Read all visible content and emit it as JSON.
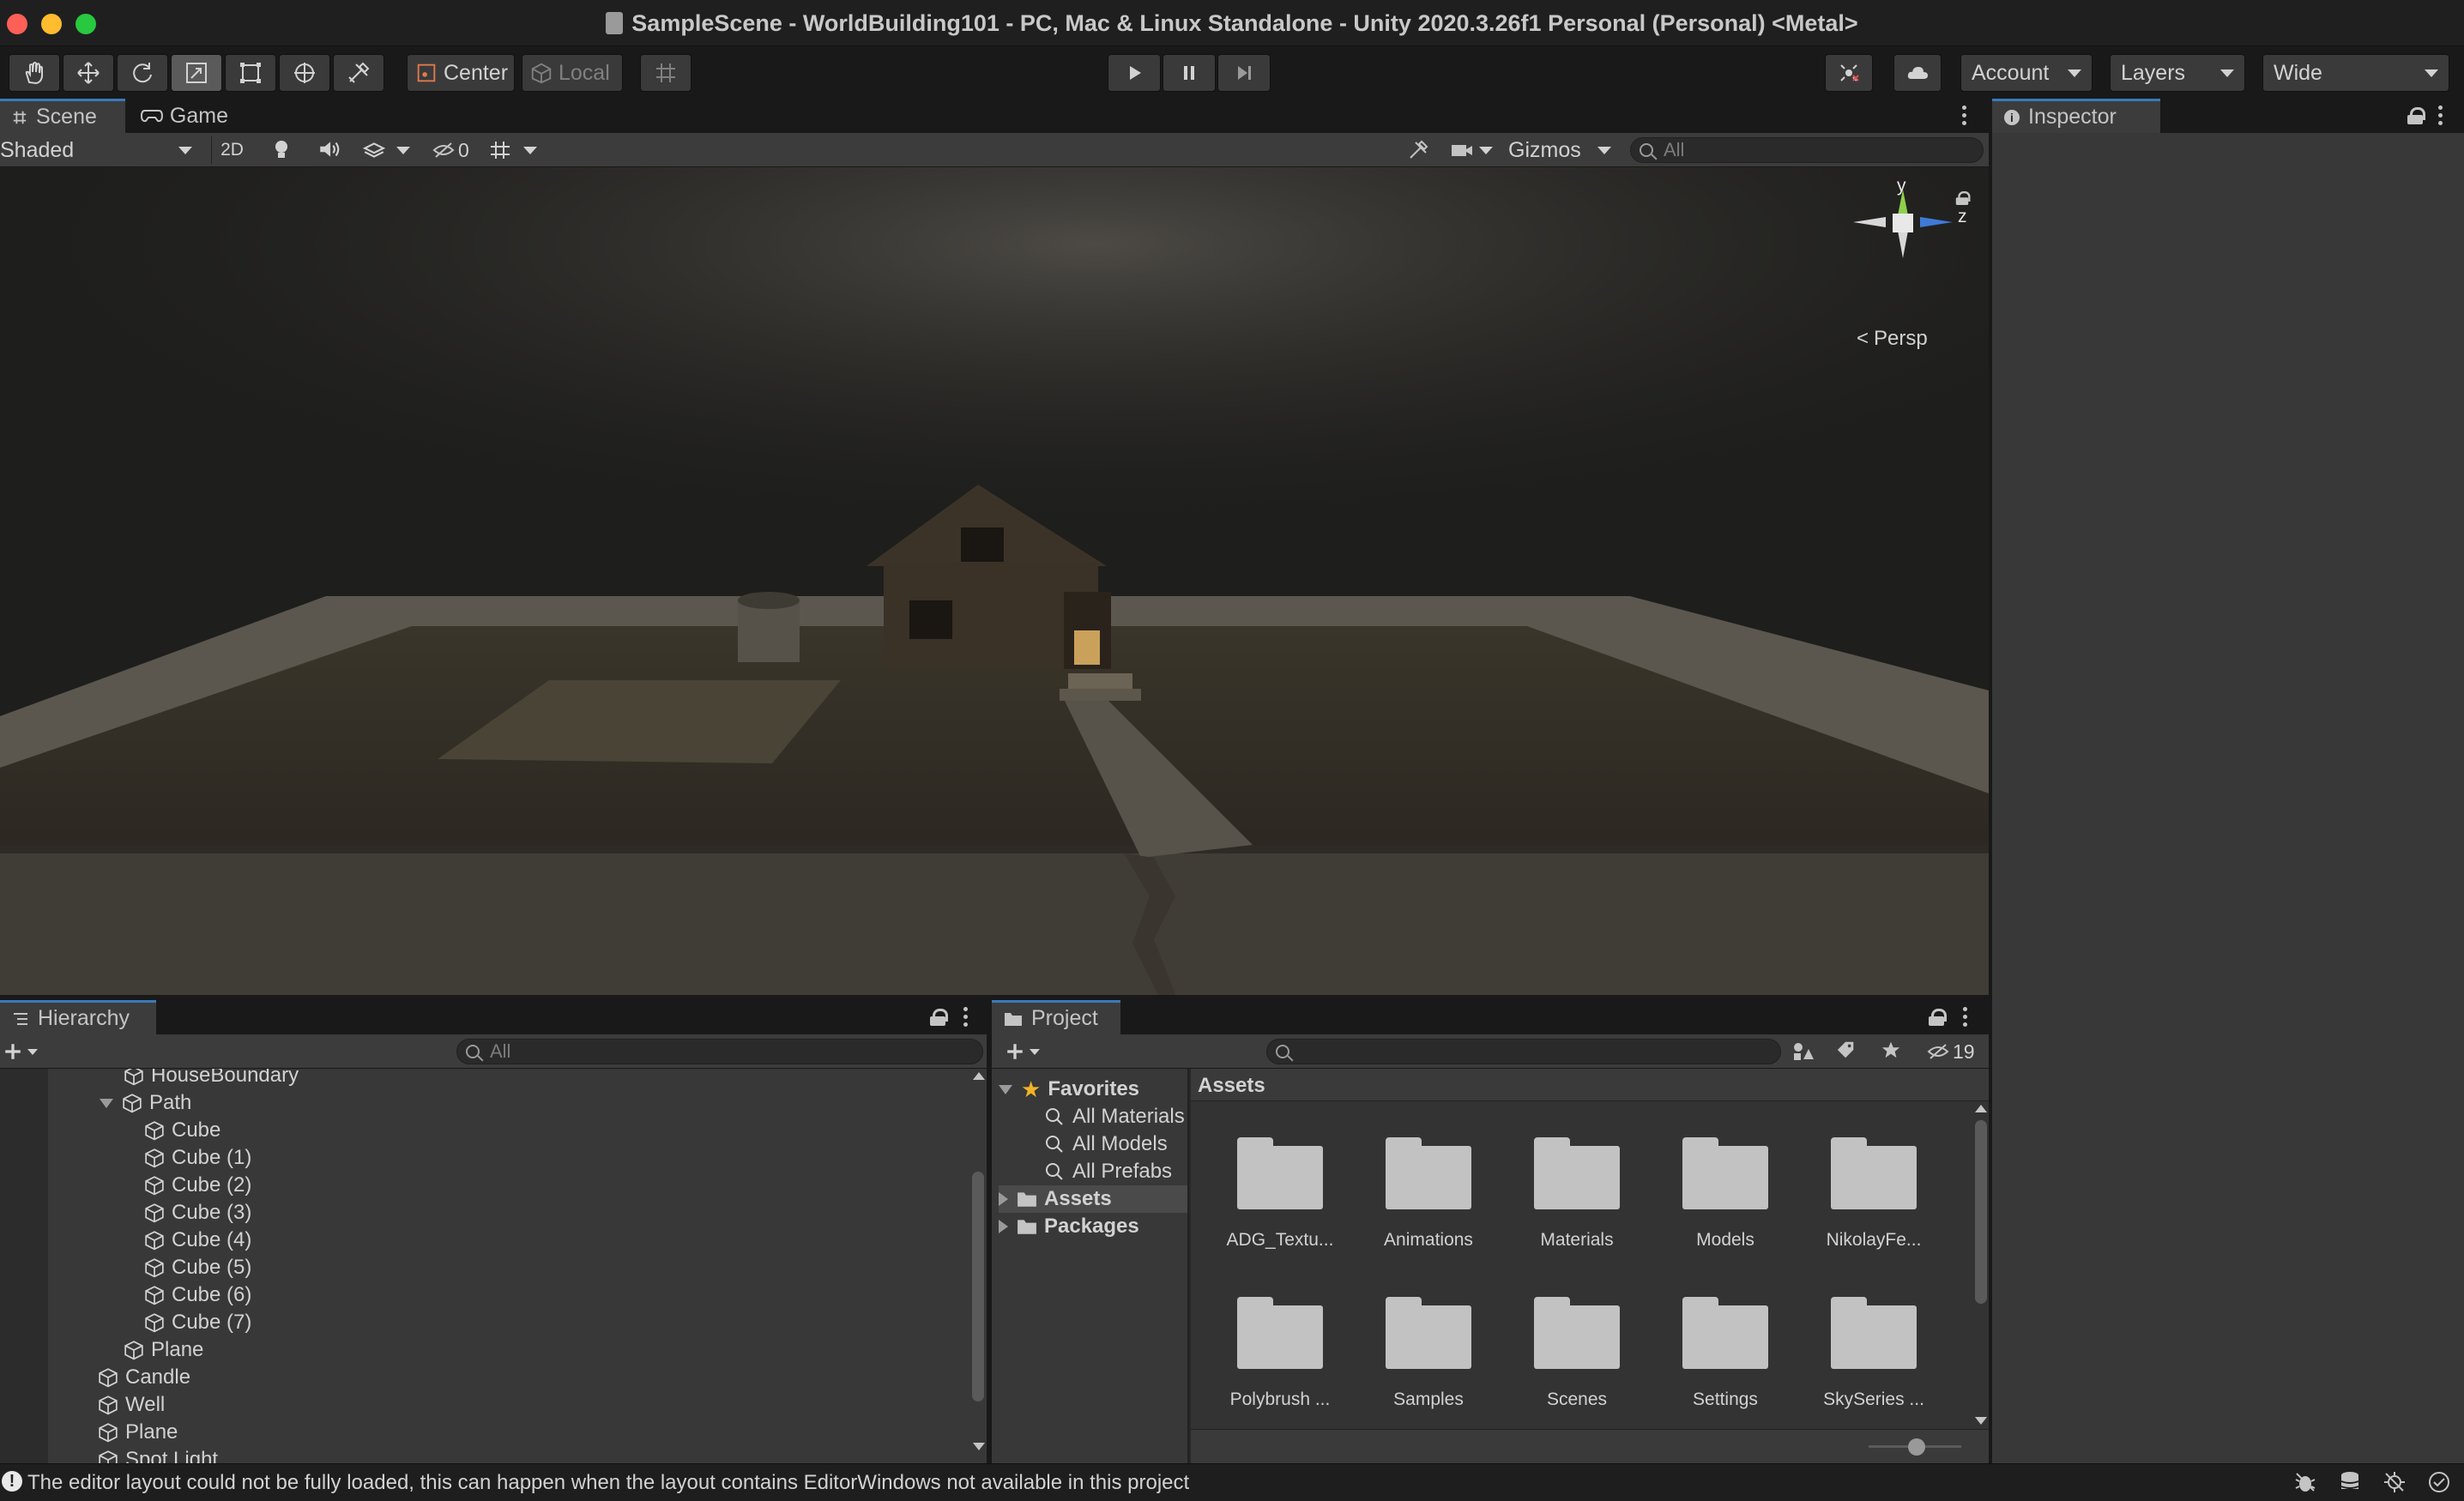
{
  "window": {
    "title": "SampleScene - WorldBuilding101 - PC, Mac & Linux Standalone - Unity 2020.3.26f1 Personal (Personal) <Metal>"
  },
  "toolbar": {
    "pivot_label": "Center",
    "space_label": "Local",
    "account_label": "Account",
    "layers_label": "Layers",
    "layout_label": "Wide"
  },
  "scene_panel": {
    "tabs": [
      {
        "label": "Scene"
      },
      {
        "label": "Game"
      }
    ],
    "shading_mode": "Shaded",
    "mode_2d_label": "2D",
    "hidden_count": "0",
    "gizmos_label": "Gizmos",
    "search_placeholder": "All",
    "gizmo": {
      "y_label": "y",
      "z_label": "z",
      "projection_label": "Persp"
    }
  },
  "inspector": {
    "tab_label": "Inspector"
  },
  "hierarchy": {
    "tab_label": "Hierarchy",
    "search_placeholder": "All",
    "items": [
      {
        "label": "HouseBoundary"
      },
      {
        "label": "Path"
      },
      {
        "label": "Cube"
      },
      {
        "label": "Cube (1)"
      },
      {
        "label": "Cube (2)"
      },
      {
        "label": "Cube (3)"
      },
      {
        "label": "Cube (4)"
      },
      {
        "label": "Cube (5)"
      },
      {
        "label": "Cube (6)"
      },
      {
        "label": "Cube (7)"
      },
      {
        "label": "Plane"
      },
      {
        "label": "Candle"
      },
      {
        "label": "Well"
      },
      {
        "label": "Plane"
      },
      {
        "label": "Spot Light"
      }
    ]
  },
  "project": {
    "tab_label": "Project",
    "hidden_count": "19",
    "tree": {
      "favorites_label": "Favorites",
      "favorites": [
        {
          "label": "All Materials"
        },
        {
          "label": "All Models"
        },
        {
          "label": "All Prefabs"
        }
      ],
      "roots": [
        {
          "label": "Assets"
        },
        {
          "label": "Packages"
        }
      ]
    },
    "breadcrumb": "Assets",
    "assets": [
      {
        "label": "ADG_Textu..."
      },
      {
        "label": "Animations"
      },
      {
        "label": "Materials"
      },
      {
        "label": "Models"
      },
      {
        "label": "NikolayFe..."
      },
      {
        "label": "Polybrush ..."
      },
      {
        "label": "Samples"
      },
      {
        "label": "Scenes"
      },
      {
        "label": "Settings"
      },
      {
        "label": "SkySeries ..."
      }
    ]
  },
  "status_bar": {
    "message": "The editor layout could not be fully loaded, this can happen when the layout contains EditorWindows not available in this project"
  }
}
